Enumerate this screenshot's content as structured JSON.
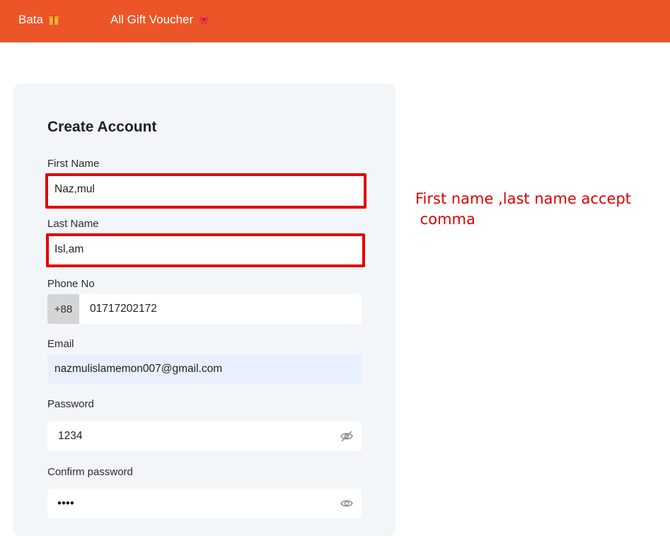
{
  "nav": {
    "items": [
      {
        "label": "Bata",
        "icon": "gift-box-icon"
      },
      {
        "label": "All Gift Voucher",
        "icon": "ribbon-bow-icon"
      }
    ]
  },
  "form": {
    "title": "Create Account",
    "first_name": {
      "label": "First Name",
      "value": "Naz,mul"
    },
    "last_name": {
      "label": "Last Name",
      "value": "Isl,am"
    },
    "phone": {
      "label": "Phone No",
      "prefix": "+88",
      "value": "01717202172"
    },
    "email": {
      "label": "Email",
      "value": "nazmulislamemon007@gmail.com"
    },
    "password": {
      "label": "Password",
      "value": "1234",
      "icon": "eye-slash-icon"
    },
    "confirm_password": {
      "label": "Confirm password",
      "value": "••••",
      "icon": "eye-icon"
    }
  },
  "annotation": {
    "line1": "First name ,last name accept",
    "line2": " comma"
  },
  "colors": {
    "brand": "#ec5528",
    "highlight": "#e60000",
    "card_bg": "#f3f6f8",
    "email_bg": "#e8f0fe"
  }
}
